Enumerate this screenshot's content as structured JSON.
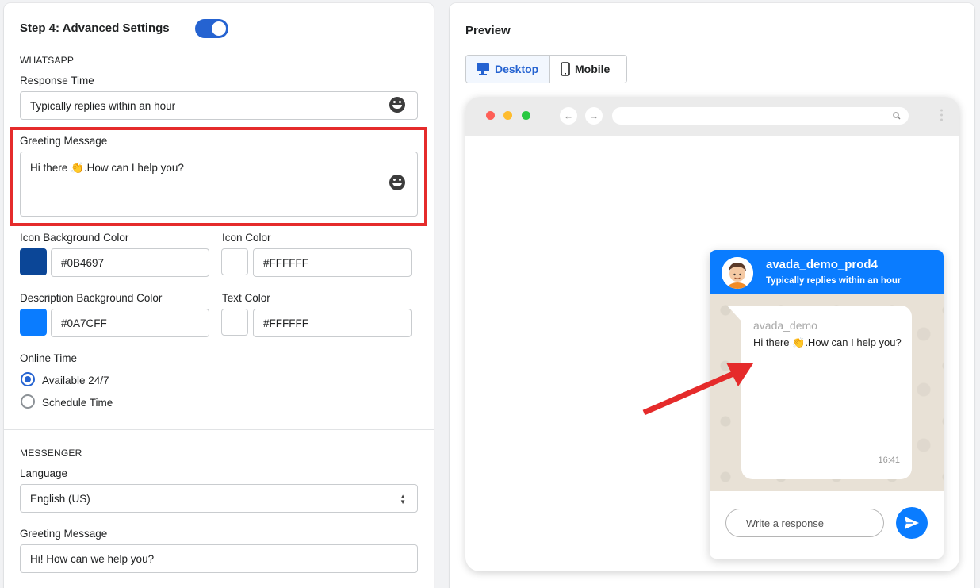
{
  "settings": {
    "step_title": "Step 4: Advanced Settings",
    "whatsapp": {
      "section_label": "WHATSAPP",
      "response_time_label": "Response Time",
      "response_time_value": "Typically replies within an hour",
      "greeting_label": "Greeting Message",
      "greeting_value": "Hi there 👏.How can I help you?",
      "icon_bg_label": "Icon Background Color",
      "icon_bg_value": "#0B4697",
      "icon_color_label": "Icon Color",
      "icon_color_value": "#FFFFFF",
      "desc_bg_label": "Description Background Color",
      "desc_bg_value": "#0A7CFF",
      "text_color_label": "Text Color",
      "text_color_value": "#FFFFFF",
      "online_time_label": "Online Time",
      "option_available": "Available 24/7",
      "option_schedule": "Schedule Time"
    },
    "messenger": {
      "section_label": "MESSENGER",
      "language_label": "Language",
      "language_value": "English (US)",
      "greeting_label": "Greeting Message",
      "greeting_value": "Hi! How can we help you?"
    }
  },
  "preview": {
    "title": "Preview",
    "desktop_label": "Desktop",
    "mobile_label": "Mobile",
    "widget": {
      "name": "avada_demo_prod4",
      "status": "Typically replies within an hour",
      "sender": "avada_demo",
      "message": "Hi there 👏.How can I help you?",
      "time": "16:41",
      "input_placeholder": "Write a response"
    }
  },
  "colors": {
    "accent": "#2563D1",
    "highlight": "#E52B2B",
    "icon_bg": "#0B4697",
    "desc_bg": "#0A7CFF"
  }
}
